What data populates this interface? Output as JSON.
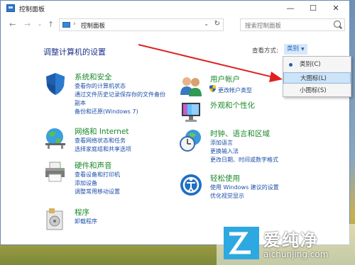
{
  "window": {
    "title": "控制面板",
    "controls": {
      "minimize": "—",
      "maximize": "☐",
      "close": "✕"
    }
  },
  "nav": {
    "back": "←",
    "forward": "→",
    "recent": "⌄",
    "up": "↑",
    "address": "控制面板",
    "address_sep": "›",
    "address_dropdown": "⌄",
    "refresh": "↻",
    "search_placeholder": "搜索控制面板"
  },
  "main": {
    "title": "调整计算机的设置",
    "view_by_label": "查看方式:",
    "view_selected": "类别",
    "view_options": [
      {
        "label": "类别(C)",
        "selected": true
      },
      {
        "label": "大图标(L)",
        "highlighted": true
      },
      {
        "label": "小图标(S)"
      }
    ]
  },
  "categories": [
    {
      "id": "system-security",
      "icon": "shield-icon",
      "title": "系统和安全",
      "links": [
        "查看你的计算机状态",
        "通过文件历史记录保存你的文件备份",
        "副本",
        "备份和还原(Windows 7)"
      ]
    },
    {
      "id": "network",
      "icon": "globe-network-icon",
      "title": "网络和 Internet",
      "links": [
        "查看网络状态和任务",
        "选择家庭组和共享选项"
      ]
    },
    {
      "id": "hardware-sound",
      "icon": "printer-icon",
      "title": "硬件和声音",
      "links": [
        "查看设备和打印机",
        "添加设备",
        "调整常用移动设置"
      ]
    },
    {
      "id": "programs",
      "icon": "programs-icon",
      "title": "程序",
      "links": [
        "卸载程序"
      ]
    },
    {
      "id": "user-accounts",
      "icon": "users-icon",
      "title": "用户帐户",
      "links": [
        "更改帐户类型"
      ]
    },
    {
      "id": "appearance",
      "icon": "monitor-icon",
      "title": "外观和个性化",
      "links": []
    },
    {
      "id": "clock-region",
      "icon": "clock-globe-icon",
      "title": "时钟、语言和区域",
      "links": [
        "添加语言",
        "更换输入法",
        "更改日期、时间或数字格式"
      ]
    },
    {
      "id": "ease-access",
      "icon": "ease-of-access-icon",
      "title": "轻松使用",
      "links": [
        "使用 Windows 建议的设置",
        "优化视觉显示"
      ]
    }
  ],
  "watermark": {
    "title": "爱纯净",
    "url": "aichunjing.com"
  },
  "colors": {
    "accent": "#1e3287",
    "category_title": "#1a8a2a",
    "link": "#1d4fa8",
    "arrow": "#e02020"
  }
}
